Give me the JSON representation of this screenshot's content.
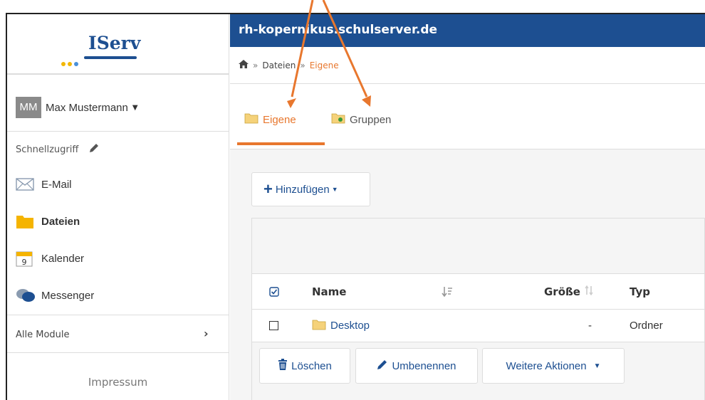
{
  "app": {
    "host": "rh-kopernikus.schulserver.de",
    "logo_text": "IServ",
    "brand_color": "#1d4f91",
    "accent_color": "#e8772e"
  },
  "user": {
    "initials": "MM",
    "name": "Max Mustermann"
  },
  "sidebar": {
    "quick_access_label": "Schnellzugriff",
    "items": [
      {
        "label": "E-Mail",
        "icon": "mail-icon"
      },
      {
        "label": "Dateien",
        "icon": "folder-icon",
        "active": true
      },
      {
        "label": "Kalender",
        "icon": "calendar-icon",
        "day": "9"
      },
      {
        "label": "Messenger",
        "icon": "chat-icon"
      }
    ],
    "all_modules_label": "Alle Module",
    "impressum_label": "Impressum"
  },
  "breadcrumb": {
    "home_icon": "home-icon",
    "items": [
      "Dateien",
      "Eigene"
    ],
    "separator": "»"
  },
  "tabs": [
    {
      "label": "Eigene",
      "active": true,
      "icon": "folder-icon"
    },
    {
      "label": "Gruppen",
      "active": false,
      "icon": "group-folder-icon"
    }
  ],
  "toolbar": {
    "add_label": "Hinzufügen"
  },
  "table": {
    "columns": {
      "name": "Name",
      "size": "Größe",
      "type": "Typ"
    },
    "rows": [
      {
        "name": "Desktop",
        "size": "-",
        "type": "Ordner"
      }
    ]
  },
  "actions": {
    "delete_label": "Löschen",
    "rename_label": "Umbenennen",
    "more_label": "Weitere Aktionen"
  }
}
